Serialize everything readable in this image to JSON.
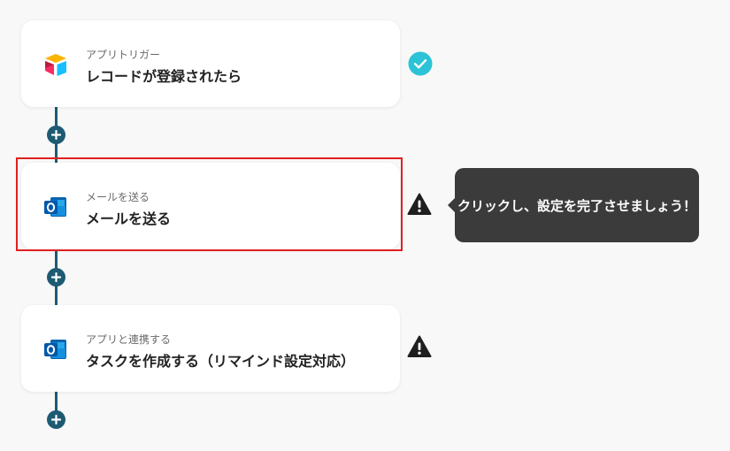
{
  "colors": {
    "connector": "#1d5b73",
    "success": "#2cc3d6",
    "warning": "#1f1f1f",
    "highlight": "#e0201f",
    "tooltip_bg": "#3b3b3b"
  },
  "steps": [
    {
      "subtitle": "アプリトリガー",
      "title": "レコードが登録されたら",
      "app_icon": "airtable-icon",
      "status_icon": "check-circle-icon"
    },
    {
      "subtitle": "メールを送る",
      "title": "メールを送る",
      "app_icon": "outlook-icon",
      "status_icon": "warning-icon"
    },
    {
      "subtitle": "アプリと連携する",
      "title": "タスクを作成する（リマインド設定対応）",
      "app_icon": "outlook-icon",
      "status_icon": "warning-icon"
    }
  ],
  "tooltip": {
    "text": "クリックし、設定を完了させましょう！"
  }
}
